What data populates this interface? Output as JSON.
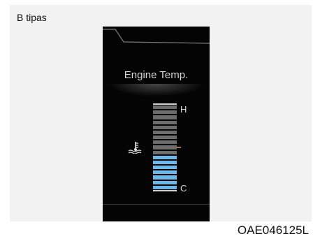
{
  "figure": {
    "caption": "B tipas",
    "code": "OAE046125L"
  },
  "display": {
    "title": "Engine Temp.",
    "gauge": {
      "high_label": "H",
      "low_label": "C",
      "total_segments": 17,
      "lit_segments": 7,
      "lit_color": "#6bb8ea",
      "unlit_color": "#6d6d6d"
    },
    "icon": "coolant-temperature-icon"
  }
}
